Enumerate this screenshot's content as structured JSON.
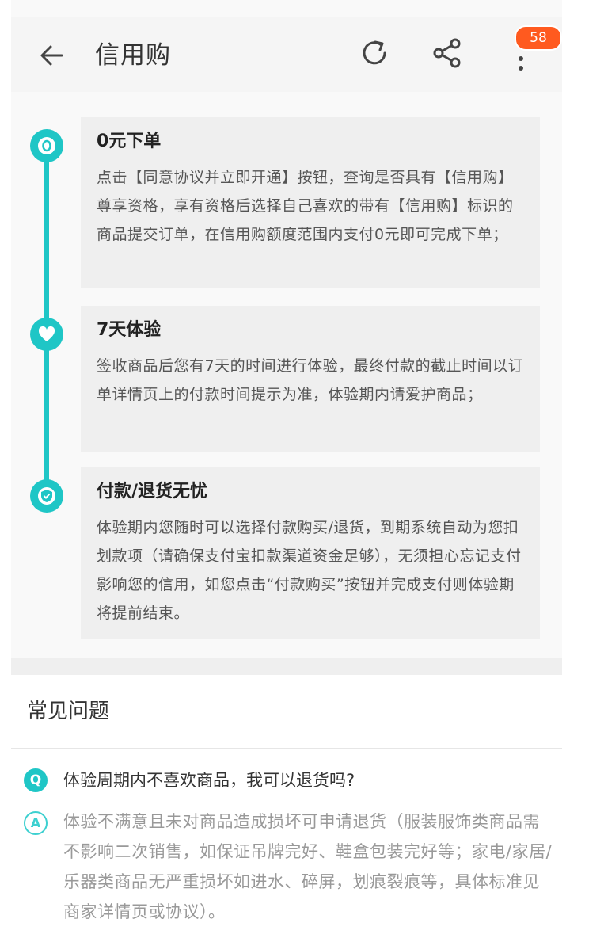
{
  "header": {
    "title": "信用购",
    "badge_count": "58",
    "icons": [
      "back-arrow-icon",
      "refresh-icon",
      "share-icon",
      "more-vertical-icon"
    ]
  },
  "steps": [
    {
      "title": "0元下单",
      "desc": "点击【同意协议并立即开通】按钮，查询是否具有【信用购】尊享资格，享有资格后选择自己喜欢的带有【信用购】标识的商品提交订单，在信用购额度范围内支付0元即可完成下单；",
      "icon": "coin-icon"
    },
    {
      "title": "7天体验",
      "desc": "签收商品后您有7天的时间进行体验，最终付款的截止时间以订单详情页上的付款时间提示为准，体验期内请爱护商品；",
      "icon": "heart-icon"
    },
    {
      "title": "付款/退货无忧",
      "desc": "体验期内您随时可以选择付款购买/退货，到期系统自动为您扣划款项（请确保支付宝扣款渠道资金足够），无须担心忘记支付影响您的信用，如您点击“付款购买”按钮并完成支付则体验期将提前结束。",
      "icon": "shield-icon"
    }
  ],
  "faq": {
    "heading": "常见问题",
    "q_mark": "Q",
    "a_mark": "A",
    "question": "体验周期内不喜欢商品，我可以退货吗?",
    "answer": "体验不满意且未对商品造成损坏可申请退货（服装服饰类商品需不影响二次销售，如保证吊牌完好、鞋盒包装完好等；家电/家居/乐器类商品无严重损坏如进水、碎屏，划痕裂痕等，具体标准见商家详情页或协议）。"
  },
  "colors": {
    "accent": "#1fc6c6",
    "badge": "#ff5a1f"
  }
}
